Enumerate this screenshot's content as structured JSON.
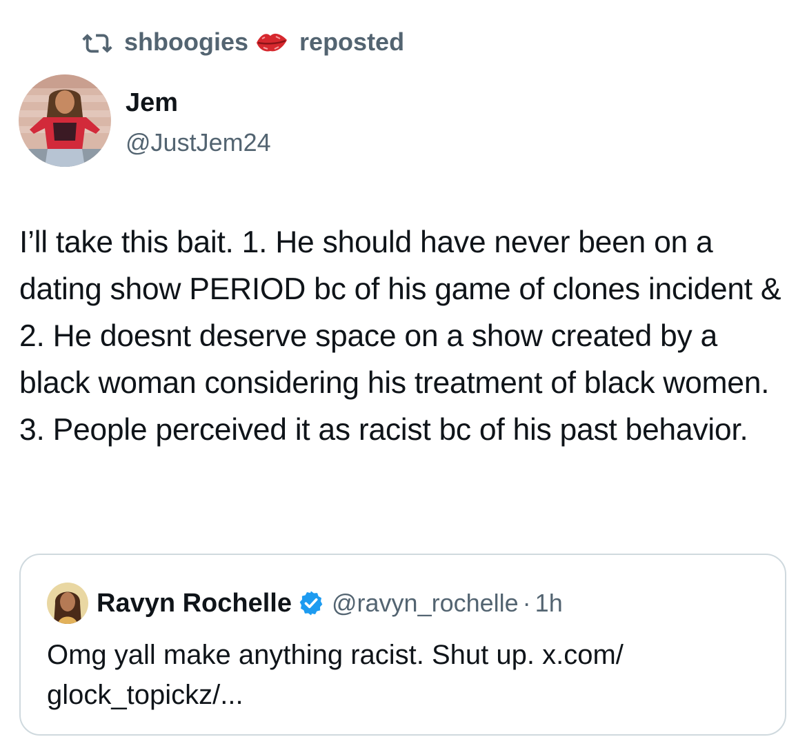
{
  "repost": {
    "icon": "repost-icon",
    "username": "shboogies",
    "emoji_icon": "kiss-lips-icon",
    "label": "reposted"
  },
  "author": {
    "name": "Jem",
    "handle": "@JustJem24",
    "avatar": "avatar"
  },
  "tweet": {
    "text": "I’ll take this bait. 1. He should have never been on a dating show PERIOD bc of his game of clones incident & 2. He doesnt deserve space on a show created by a black woman considering his treatment of black women. 3. People perceived it as racist bc of his past behavior."
  },
  "quote": {
    "name": "Ravyn Rochelle",
    "verified_icon": "verified-badge-icon",
    "handle": "@ravyn_rochelle",
    "dot": "·",
    "time": "1h",
    "text": "Omg yall make anything racist. Shut up. x.com/ glock_topickz/..."
  },
  "colors": {
    "primary_text": "#0f1419",
    "secondary_text": "#536471",
    "border": "#cfd9de",
    "verified_blue": "#1d9bf0",
    "lips_red": "#d6282e"
  }
}
